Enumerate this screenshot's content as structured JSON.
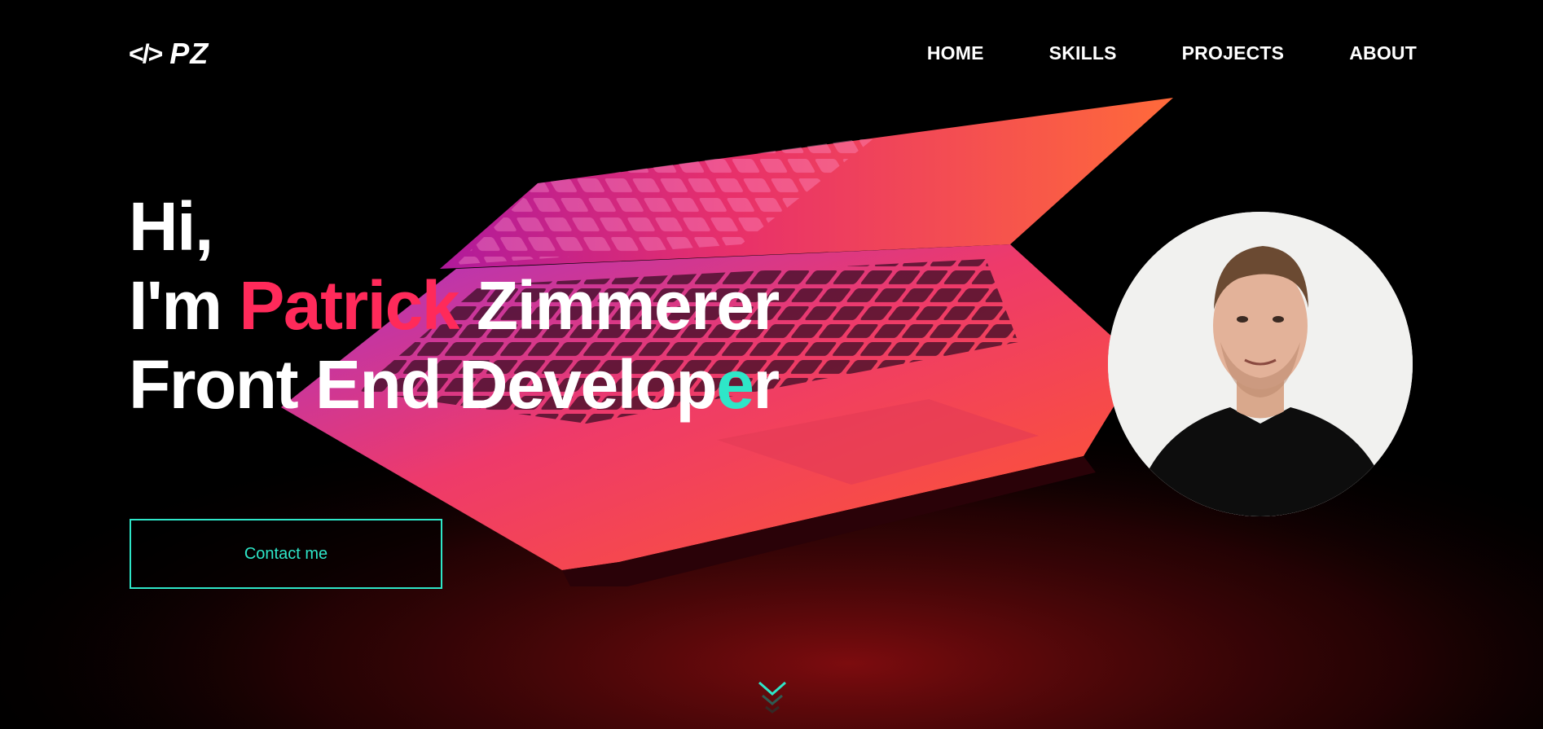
{
  "brand": {
    "logo_icon": "</>",
    "logo_text": "PZ"
  },
  "nav": {
    "items": [
      {
        "label": "HOME"
      },
      {
        "label": "SKILLS"
      },
      {
        "label": "PROJECTS"
      },
      {
        "label": "ABOUT"
      }
    ]
  },
  "hero": {
    "line1": "Hi,",
    "line2_prefix": "I'm ",
    "line2_first_name": "Patrick",
    "line2_last_name": " Zimmerer",
    "line3_main": "Front End Develop",
    "line3_accent": "e",
    "line3_end": "r",
    "cta_label": "Contact me"
  },
  "colors": {
    "accent_red": "#ff2a5a",
    "accent_teal": "#2ee6c8",
    "background": "#000000"
  },
  "icons": {
    "logo": "code-brackets-icon",
    "scroll": "chevron-down-icon"
  }
}
